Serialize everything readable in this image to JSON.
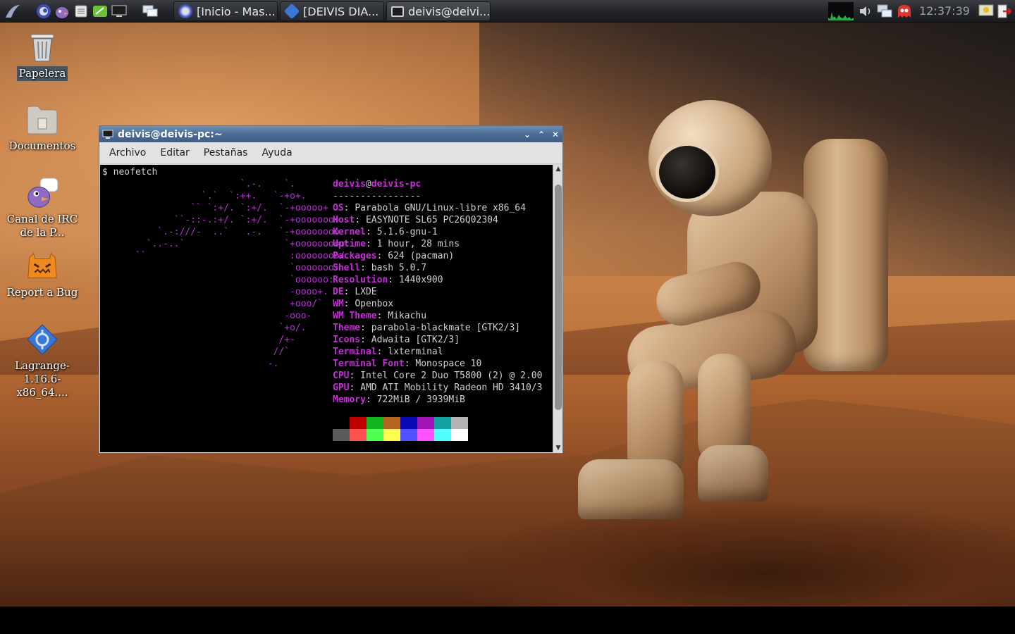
{
  "panel": {
    "launchers": [
      {
        "icon": "parabola-menu-icon"
      },
      {
        "icon": "browser-icon"
      },
      {
        "icon": "pidgin-icon"
      },
      {
        "icon": "file-manager-icon"
      },
      {
        "icon": "text-editor-icon"
      },
      {
        "icon": "terminal-icon"
      },
      {
        "icon": "window-switcher-icon"
      }
    ],
    "tasks": [
      {
        "label": "[Inicio - Mas...",
        "icon": "browser-icon"
      },
      {
        "label": "[DEIVIS DIA...",
        "icon": "lagrange-icon"
      },
      {
        "label": "deivis@deivi...",
        "icon": "terminal-icon"
      }
    ],
    "tray": [
      "cpu-monitor-icon",
      "volume-icon",
      "network-icon",
      "pacman-ghost-icon"
    ],
    "clock": "12:37:39",
    "tray_right": [
      "weather-icon",
      "logout-icon"
    ]
  },
  "desktop_icons": [
    {
      "label": "Papelera",
      "icon": "trash-icon"
    },
    {
      "label": "Documentos",
      "icon": "folder-icon"
    },
    {
      "label": "Canal de IRC de la P...",
      "icon": "pidgin-chat-icon"
    },
    {
      "label": "Report a Bug",
      "icon": "bug-monster-icon"
    },
    {
      "label": "Lagrange-1.16.6-x86_64....",
      "icon": "lagrange-app-icon"
    }
  ],
  "terminal": {
    "title": "deivis@deivis-pc:~",
    "menu": [
      "Archivo",
      "Editar",
      "Pestañas",
      "Ayuda"
    ],
    "prompt": "$ neofetch",
    "ascii_art": "                         `.-.    `.\n                  `.`  `:++.   `-+o+.\n                `` `:+/. `:+/.  `-+ooooo+\n             ``-::-.:+/. `:+/.  `-+ooooooo+\n          `.-:///-  ..`   .-.   `-+oooooooo-\n        `..-..`                  `+ooooooooo:\n      ``                          :oooooooo/\n                                  `ooooooo:\n                                  `oooooo:\n                                  -oooo+.\n                                  +ooo/`\n                                 -ooo-\n                                `+o/.\n                                /+-\n                               //`\n                              -.",
    "user": "deivis",
    "at": "@",
    "host": "deivis-pc",
    "separator": "----------------",
    "info": [
      {
        "key": "OS",
        "value": "Parabola GNU/Linux-libre x86_64"
      },
      {
        "key": "Host",
        "value": "EASYNOTE SL65 PC26Q02304"
      },
      {
        "key": "Kernel",
        "value": "5.1.6-gnu-1"
      },
      {
        "key": "Uptime",
        "value": "1 hour, 28 mins"
      },
      {
        "key": "Packages",
        "value": "624 (pacman)"
      },
      {
        "key": "Shell",
        "value": "bash 5.0.7"
      },
      {
        "key": "Resolution",
        "value": "1440x900"
      },
      {
        "key": "DE",
        "value": "LXDE"
      },
      {
        "key": "WM",
        "value": "Openbox"
      },
      {
        "key": "WM Theme",
        "value": "Mikachu"
      },
      {
        "key": "Theme",
        "value": "parabola-blackmate [GTK2/3]"
      },
      {
        "key": "Icons",
        "value": "Adwaita [GTK2/3]"
      },
      {
        "key": "Terminal",
        "value": "lxterminal"
      },
      {
        "key": "Terminal Font",
        "value": "Monospace 10"
      },
      {
        "key": "CPU",
        "value": "Intel Core 2 Duo T5800 (2) @ 2.00"
      },
      {
        "key": "GPU",
        "value": "AMD ATI Mobility Radeon HD 3410/3"
      },
      {
        "key": "Memory",
        "value": "722MiB / 3939MiB"
      }
    ],
    "palette_row1": [
      "#000000",
      "#c00000",
      "#14b41e",
      "#b4641e",
      "#0a0ab4",
      "#a014b4",
      "#14a0a0",
      "#b4b4b4"
    ],
    "palette_row2": [
      "#5a5a5a",
      "#ff5050",
      "#50ff50",
      "#ffff50",
      "#5050ff",
      "#ff50ff",
      "#50ffff",
      "#ffffff"
    ]
  }
}
